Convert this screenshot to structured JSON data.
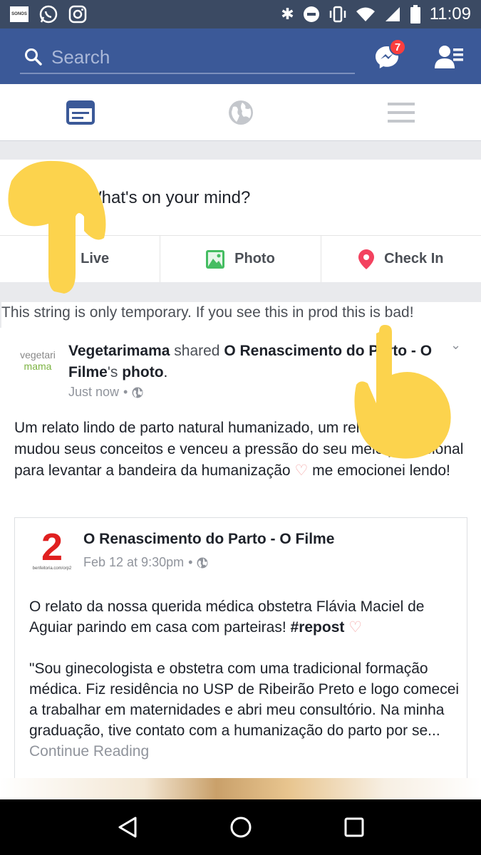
{
  "status_bar": {
    "sonos_label": "SONOS",
    "time": "11:09"
  },
  "header": {
    "search_placeholder": "Search",
    "messenger_badge": "7"
  },
  "composer": {
    "prompt": "What's on your mind?",
    "actions": [
      {
        "label": "Live",
        "icon": "video-icon",
        "color": "#f02849"
      },
      {
        "label": "Photo",
        "icon": "photo-icon",
        "color": "#45bd62"
      },
      {
        "label": "Check In",
        "icon": "location-pin-icon",
        "color": "#f3425f"
      }
    ]
  },
  "debug_notice": "This string is only temporary. If you see this in prod this is bad!",
  "post": {
    "author": "Vegetarimama",
    "shared_word": "shared",
    "shared_page": "O Renascimento do Parto - O Filme",
    "possessive": "'s",
    "photo_word": "photo",
    "avatar_text_1": "vegetari",
    "avatar_text_2": "mama",
    "time": "Just now",
    "body": "Um relato lindo de parto natural humanizado, um relato de quem mudou seus conceitos e venceu a pressão do seu meio profissional para levantar a bandeira da humanização",
    "body_end": " me emocionei lendo!"
  },
  "shared_post": {
    "logo_number": "2",
    "logo_url": "benfeitoria.com/orp2",
    "title": "O Renascimento do Parto - O Filme",
    "time": "Feb 12 at 9:30pm",
    "paragraph_1": "O relato da nossa querida médica obstetra Flávia Maciel de Aguiar parindo em casa com parteiras!",
    "hashtag": "#repost",
    "paragraph_2": "\"Sou ginecologista e obstetra com uma tradicional formação médica. Fiz residência no USP de Ribeirão Preto e logo comecei a trabalhar em maternidades e abri meu consultório. Na minha graduação, tive contato com a humanização do parto por se...",
    "continue": "Continue Reading"
  },
  "colors": {
    "fb_blue": "#3b5998",
    "hand_yellow": "#fcd34d"
  }
}
